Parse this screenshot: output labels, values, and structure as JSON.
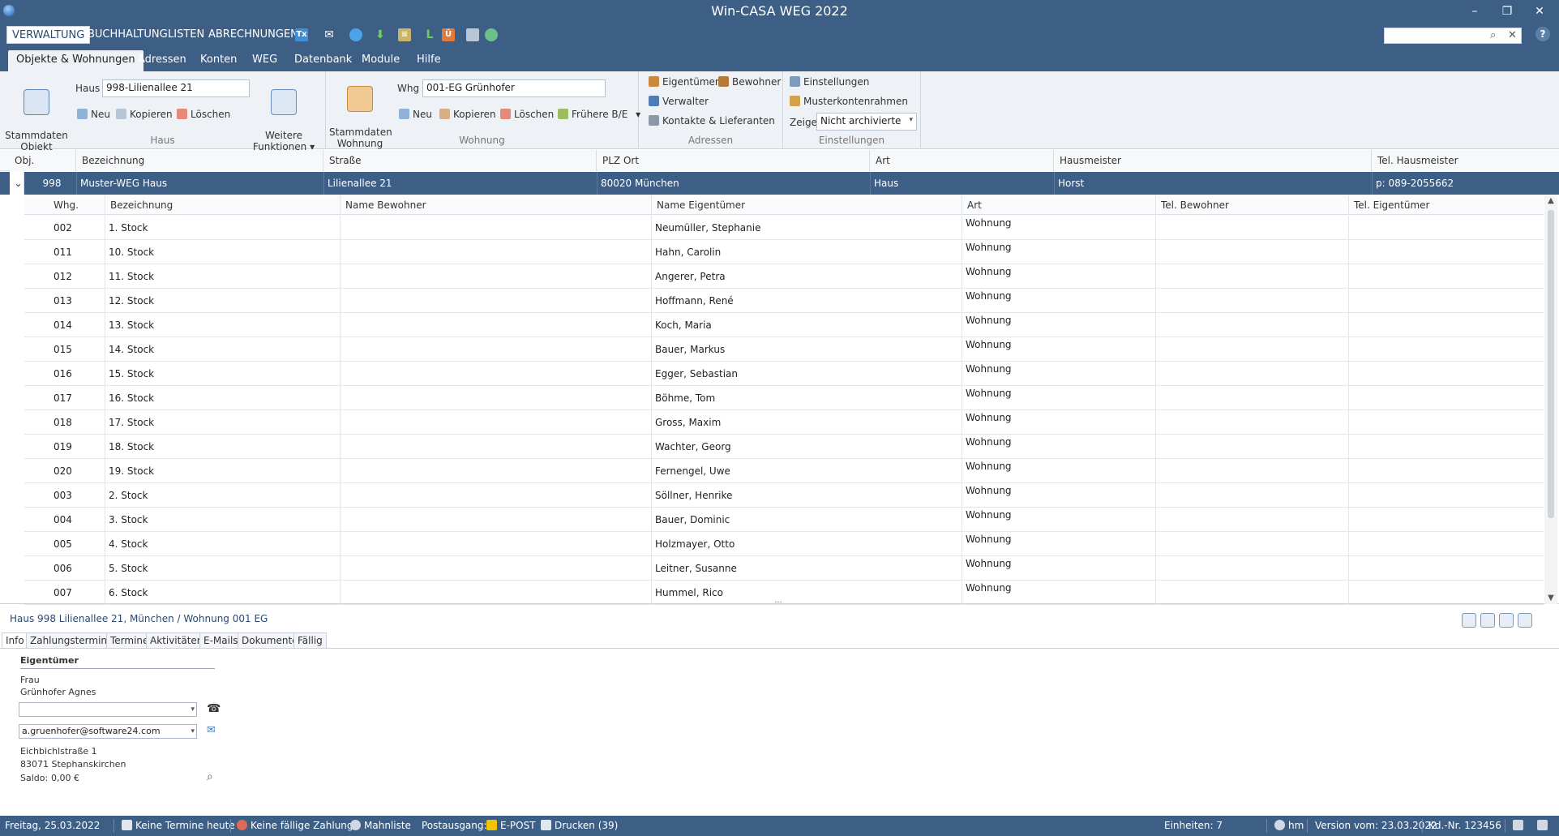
{
  "window": {
    "title": "Win-CASA WEG 2022",
    "minimize": "–",
    "restore": "❐",
    "close": "✕"
  },
  "menu": {
    "items": [
      "VERWALTUNG",
      "BUCHHALTUNG",
      "LISTEN",
      "ABRECHNUNGEN"
    ],
    "toolbar_icons": [
      "tx-icon",
      "mail-icon",
      "tag-icon",
      "download-icon",
      "list-icon",
      "l-icon",
      "u-icon",
      "copy-icon",
      "refresh-icon"
    ],
    "tx_label": "Tx",
    "l_label": "L",
    "u_label": "Ü",
    "search_placeholder": ""
  },
  "ribbon_tabs": [
    "Objekte & Wohnungen",
    "Adressen",
    "Konten",
    "WEG",
    "Datenbank",
    "Module",
    "Hilfe"
  ],
  "ribbon": {
    "haus": {
      "group_label": "Haus",
      "stammdaten_objekt": "Stammdaten\nObjekt",
      "haus_label": "Haus",
      "haus_value": "998-Lilienallee 21",
      "neu": "Neu",
      "kopieren": "Kopieren",
      "loeschen": "Löschen",
      "weitere_funktionen": "Weitere\nFunktionen ▾"
    },
    "wohnung": {
      "group_label": "Wohnung",
      "stammdaten_wohnung": "Stammdaten\nWohnung",
      "whg_label": "Whg",
      "whg_value": "001-EG  Grünhofer",
      "neu": "Neu",
      "kopieren": "Kopieren",
      "loeschen": "Löschen",
      "fruehere": "Frühere B/E",
      "dropdown": "▾"
    },
    "adressen": {
      "group_label": "Adressen",
      "eigentuemer": "Eigentümer",
      "bewohner": "Bewohner",
      "verwalter": "Verwalter",
      "kontakte": "Kontakte & Lieferanten"
    },
    "einstellungen": {
      "group_label": "Einstellungen",
      "einstellungen": "Einstellungen",
      "musterkontenrahmen": "Musterkontenrahmen",
      "zeige_label": "Zeige",
      "zeige_value": "Nicht archivierte"
    }
  },
  "master": {
    "headers": [
      "Obj.",
      "Bezeichnung",
      "Straße",
      "PLZ Ort",
      "Art",
      "Hausmeister",
      "Tel. Hausmeister"
    ],
    "row": {
      "expander": "⌄",
      "obj": "998",
      "bezeichnung": "Muster-WEG Haus",
      "strasse": "Lilienallee 21",
      "plz_ort": "80020 München",
      "art": "Haus",
      "hausmeister": "Horst",
      "tel": "p: 089-2055662"
    }
  },
  "detail": {
    "headers": [
      "Whg.",
      "Bezeichnung",
      "Name Bewohner",
      "Name Eigentümer",
      "Art",
      "Tel. Bewohner",
      "Tel. Eigentümer"
    ],
    "rows": [
      {
        "whg": "002",
        "bez": "1. Stock",
        "bewohner": "",
        "eigentuemer": "Neumüller, Stephanie",
        "art": "Wohnung"
      },
      {
        "whg": "011",
        "bez": "10. Stock",
        "bewohner": "",
        "eigentuemer": "Hahn, Carolin",
        "art": "Wohnung"
      },
      {
        "whg": "012",
        "bez": "11. Stock",
        "bewohner": "",
        "eigentuemer": "Angerer, Petra",
        "art": "Wohnung"
      },
      {
        "whg": "013",
        "bez": "12. Stock",
        "bewohner": "",
        "eigentuemer": "Hoffmann, René",
        "art": "Wohnung"
      },
      {
        "whg": "014",
        "bez": "13. Stock",
        "bewohner": "",
        "eigentuemer": "Koch, Maria",
        "art": "Wohnung"
      },
      {
        "whg": "015",
        "bez": "14. Stock",
        "bewohner": "",
        "eigentuemer": "Bauer, Markus",
        "art": "Wohnung"
      },
      {
        "whg": "016",
        "bez": "15. Stock",
        "bewohner": "",
        "eigentuemer": "Egger, Sebastian",
        "art": "Wohnung"
      },
      {
        "whg": "017",
        "bez": "16. Stock",
        "bewohner": "",
        "eigentuemer": "Böhme, Tom",
        "art": "Wohnung"
      },
      {
        "whg": "018",
        "bez": "17. Stock",
        "bewohner": "",
        "eigentuemer": "Gross, Maxim",
        "art": "Wohnung"
      },
      {
        "whg": "019",
        "bez": "18. Stock",
        "bewohner": "",
        "eigentuemer": "Wachter, Georg",
        "art": "Wohnung"
      },
      {
        "whg": "020",
        "bez": "19. Stock",
        "bewohner": "",
        "eigentuemer": "Fernengel, Uwe",
        "art": "Wohnung"
      },
      {
        "whg": "003",
        "bez": "2. Stock",
        "bewohner": "",
        "eigentuemer": "Söllner, Henrike",
        "art": "Wohnung"
      },
      {
        "whg": "004",
        "bez": "3. Stock",
        "bewohner": "",
        "eigentuemer": "Bauer, Dominic",
        "art": "Wohnung"
      },
      {
        "whg": "005",
        "bez": "4. Stock",
        "bewohner": "",
        "eigentuemer": "Holzmayer, Otto",
        "art": "Wohnung"
      },
      {
        "whg": "006",
        "bez": "5. Stock",
        "bewohner": "",
        "eigentuemer": "Leitner, Susanne",
        "art": "Wohnung"
      },
      {
        "whg": "007",
        "bez": "6. Stock",
        "bewohner": "",
        "eigentuemer": "Hummel, Rico",
        "art": "Wohnung"
      }
    ]
  },
  "panel": {
    "title": "Haus 998 Lilienallee 21, München / Wohnung 001 EG",
    "tabs": [
      "Info",
      "Zahlungstermine",
      "Termine",
      "Aktivitäten",
      "E-Mails",
      "Dokumente",
      "Fällig"
    ],
    "section_title": "Eigentümer",
    "anrede": "Frau",
    "name": "Grünhofer Agnes",
    "phone_value": "",
    "email_value": "a.gruenhofer@software24.com",
    "strasse": "Eichbichlstraße 1",
    "ort": "83071 Stephanskirchen",
    "saldo_label": "Saldo:",
    "saldo_value": "0,00 €"
  },
  "status": {
    "date": "Freitag, 25.03.2022",
    "termine": "Keine Termine heute",
    "zahlung": "Keine fällige Zahlung",
    "mahnliste": "Mahnliste",
    "postausgang": "Postausgang:",
    "epost": "E-POST",
    "drucken": "Drucken (39)",
    "einheiten": "Einheiten: 7",
    "user": "hm",
    "version": "Version vom: 23.03.2022",
    "kdnr": "Kd.-Nr. 123456"
  }
}
